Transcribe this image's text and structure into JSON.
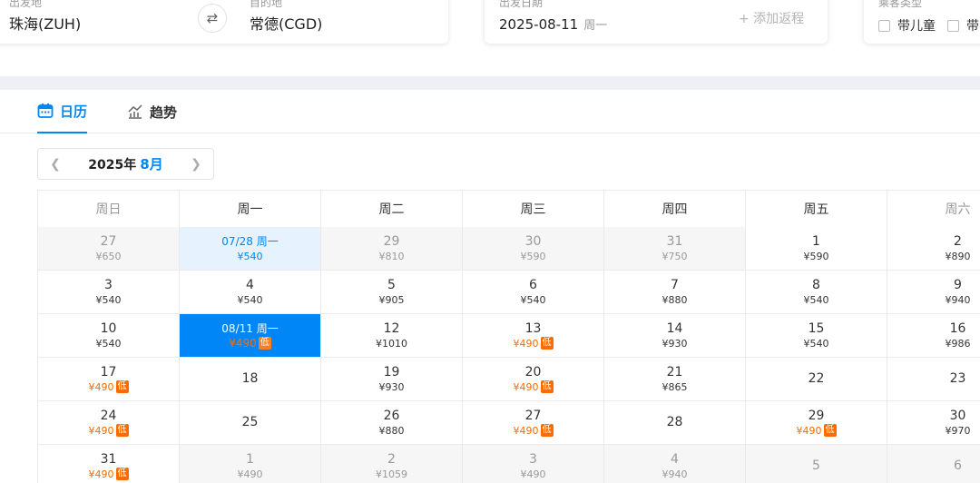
{
  "search": {
    "departure": {
      "label": "出发地",
      "value": "珠海(ZUH)"
    },
    "destination": {
      "label": "目的地",
      "value": "常德(CGD)"
    },
    "date": {
      "label": "出发日期",
      "value": "2025-08-11",
      "weekday": "周一"
    },
    "add_return": "+ 添加返程",
    "passenger": {
      "label": "乘客类型",
      "options": [
        "带儿童",
        "带"
      ]
    }
  },
  "tabs": [
    {
      "label": "日历",
      "icon": "calendar-icon",
      "active": true
    },
    {
      "label": "趋势",
      "icon": "trend-chart-icon",
      "active": false
    }
  ],
  "month_nav": {
    "year": "2025年",
    "month": "8月"
  },
  "calendar": {
    "low_tag": "低",
    "weekdays": [
      "周日",
      "周一",
      "周二",
      "周三",
      "周四",
      "周五",
      "周六"
    ],
    "weeks": [
      [
        {
          "day": "27",
          "price": "¥650",
          "state": "other"
        },
        {
          "day": "07/28 周一",
          "price": "¥540",
          "state": "other-sel"
        },
        {
          "day": "29",
          "price": "¥810",
          "state": "other"
        },
        {
          "day": "30",
          "price": "¥590",
          "state": "other"
        },
        {
          "day": "31",
          "price": "¥750",
          "state": "other"
        },
        {
          "day": "1",
          "price": "¥590",
          "state": "normal"
        },
        {
          "day": "2",
          "price": "¥890",
          "state": "normal"
        }
      ],
      [
        {
          "day": "3",
          "price": "¥540",
          "state": "normal"
        },
        {
          "day": "4",
          "price": "¥540",
          "state": "normal"
        },
        {
          "day": "5",
          "price": "¥905",
          "state": "normal"
        },
        {
          "day": "6",
          "price": "¥540",
          "state": "normal"
        },
        {
          "day": "7",
          "price": "¥880",
          "state": "normal"
        },
        {
          "day": "8",
          "price": "¥540",
          "state": "normal"
        },
        {
          "day": "9",
          "price": "¥940",
          "state": "normal"
        }
      ],
      [
        {
          "day": "10",
          "price": "¥540",
          "state": "normal"
        },
        {
          "day": "08/11 周一",
          "price": "¥490",
          "state": "selected",
          "low": true
        },
        {
          "day": "12",
          "price": "¥1010",
          "state": "normal"
        },
        {
          "day": "13",
          "price": "¥490",
          "state": "normal",
          "low": true
        },
        {
          "day": "14",
          "price": "¥930",
          "state": "normal"
        },
        {
          "day": "15",
          "price": "¥540",
          "state": "normal"
        },
        {
          "day": "16",
          "price": "¥986",
          "state": "normal"
        }
      ],
      [
        {
          "day": "17",
          "price": "¥490",
          "state": "normal",
          "low": true
        },
        {
          "day": "18",
          "price": "",
          "state": "normal"
        },
        {
          "day": "19",
          "price": "¥930",
          "state": "normal"
        },
        {
          "day": "20",
          "price": "¥490",
          "state": "normal",
          "low": true
        },
        {
          "day": "21",
          "price": "¥865",
          "state": "normal"
        },
        {
          "day": "22",
          "price": "",
          "state": "normal"
        },
        {
          "day": "23",
          "price": "",
          "state": "normal"
        }
      ],
      [
        {
          "day": "24",
          "price": "¥490",
          "state": "normal",
          "low": true
        },
        {
          "day": "25",
          "price": "",
          "state": "normal"
        },
        {
          "day": "26",
          "price": "¥880",
          "state": "normal"
        },
        {
          "day": "27",
          "price": "¥490",
          "state": "normal",
          "low": true
        },
        {
          "day": "28",
          "price": "",
          "state": "normal"
        },
        {
          "day": "29",
          "price": "¥490",
          "state": "normal",
          "low": true
        },
        {
          "day": "30",
          "price": "¥970",
          "state": "normal"
        }
      ],
      [
        {
          "day": "31",
          "price": "¥490",
          "state": "normal",
          "low": true
        },
        {
          "day": "1",
          "price": "¥490",
          "state": "other"
        },
        {
          "day": "2",
          "price": "¥1059",
          "state": "other"
        },
        {
          "day": "3",
          "price": "¥490",
          "state": "other"
        },
        {
          "day": "4",
          "price": "¥940",
          "state": "other"
        },
        {
          "day": "5",
          "price": "",
          "state": "other"
        },
        {
          "day": "6",
          "price": "",
          "state": "other"
        }
      ]
    ]
  },
  "colors": {
    "accent": "#0086f6",
    "low_price": "#ff6b00"
  }
}
